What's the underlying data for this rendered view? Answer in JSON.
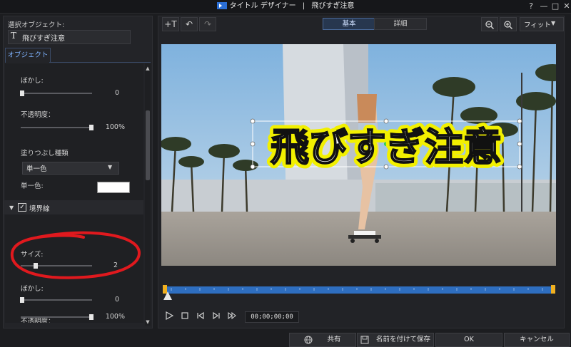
{
  "window": {
    "app_name": "タイトル デザイナー",
    "separator": "|",
    "doc_name": "飛びすぎ注意",
    "help": "?",
    "minimize": "—",
    "maximize": "□",
    "close": "✕"
  },
  "left": {
    "selected_label": "選択オブジェクト:",
    "object_name": "飛びすぎ注意",
    "object_type_glyph": "T",
    "tab_object": "オブジェクト",
    "blur_label": "ぼかし:",
    "blur_value": "0",
    "opacity_label": "不透明度：",
    "opacity_value": "100%",
    "fill_type_label": "塗りつぶし種類",
    "fill_type_value": "単一色",
    "single_color_label": "単一色:",
    "border_section_label": "境界線",
    "size_label": "サイズ:",
    "size_value": "2",
    "border_blur_label": "ぼかし:",
    "border_blur_value": "0",
    "border_opacity_label": "不透明度：",
    "border_opacity_value": "100%"
  },
  "toolbar": {
    "add_text": "+T",
    "undo": "↶",
    "redo": "↷",
    "mode_basic": "基本",
    "mode_detail": "詳細",
    "zoom_out": "−",
    "zoom_in": "+",
    "fit": "フィット"
  },
  "preview": {
    "title_text": "飛びすぎ注意"
  },
  "player": {
    "timecode": "00;00;00;00"
  },
  "bottom": {
    "share": "共有",
    "save_as": "名前を付けて保存",
    "ok": "OK",
    "cancel": "キャンセル"
  },
  "colors": {
    "accent": "#4a6a99",
    "timeline": "#2e6ec0",
    "marker": "#f0b020",
    "annotation": "#e0191e",
    "text_glow": "#f2f000"
  },
  "slider_levels": {
    "blur": 0,
    "opacity": 100,
    "size": 2,
    "border_blur": 0,
    "border_opacity": 100
  }
}
